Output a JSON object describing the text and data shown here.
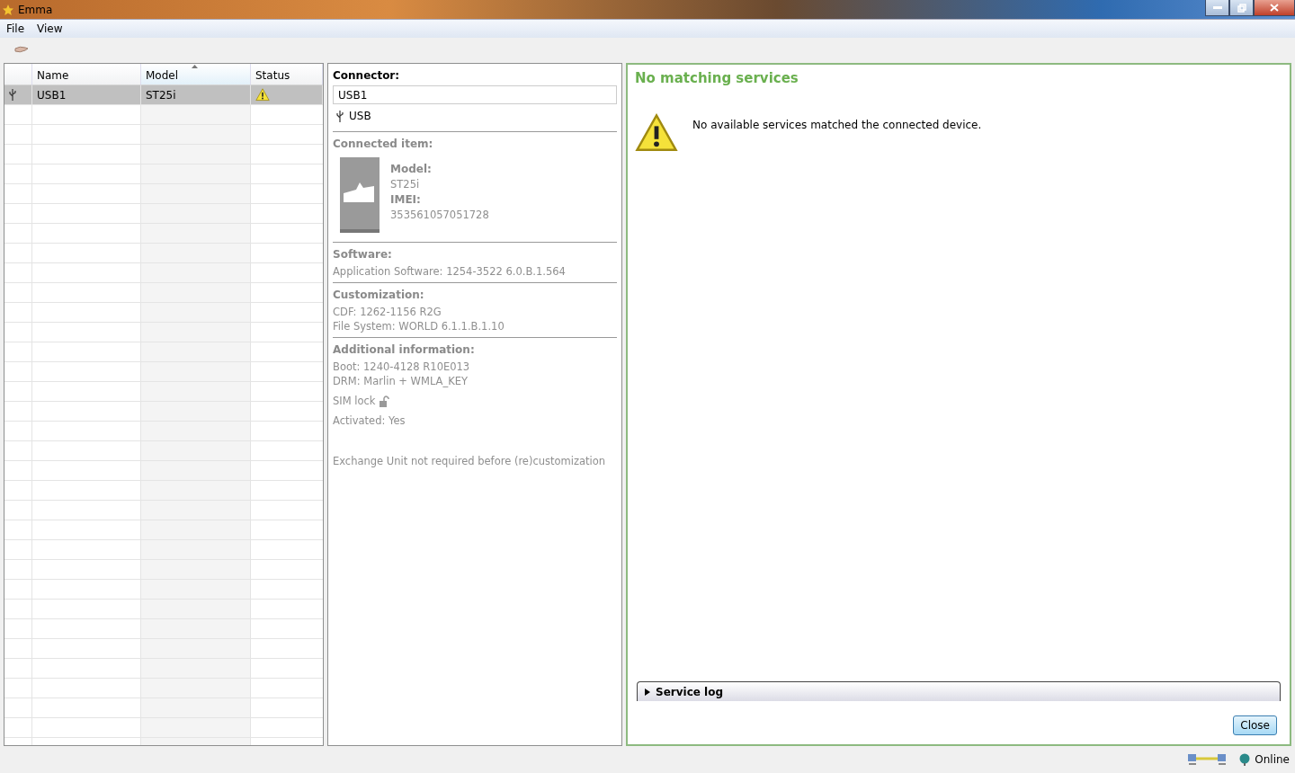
{
  "window": {
    "title": "Emma"
  },
  "menu": [
    "File",
    "View"
  ],
  "table": {
    "columns": [
      {
        "label": "Name",
        "sorted": false
      },
      {
        "label": "Model",
        "sorted": true
      },
      {
        "label": "Status",
        "sorted": false
      }
    ],
    "rows": [
      {
        "name": "USB1",
        "model": "ST25i",
        "kind": "warning",
        "selected": true
      }
    ]
  },
  "details": {
    "connector_label": "Connector:",
    "connector_value": "USB1",
    "connector_type": "USB",
    "connected_item_label": "Connected item:",
    "item_fields": [
      {
        "label": "Model:",
        "value": "ST25i"
      },
      {
        "label": "IMEI:",
        "value": "353561057051728"
      }
    ],
    "sections": [
      {
        "title": "Software:",
        "lines": [
          "Application Software: 1254-3522 6.0.B.1.564"
        ]
      },
      {
        "title": "Customization:",
        "lines": [
          "CDF: 1262-1156 R2G",
          "File System: WORLD 6.1.1.B.1.10"
        ]
      },
      {
        "title": "Additional information:",
        "lines": [
          "Boot: 1240-4128 R10E013",
          "DRM: Marlin + WMLA_KEY"
        ]
      }
    ],
    "sim_lock": {
      "label": "SIM lock",
      "locked": false
    },
    "activated": "Activated: Yes",
    "note": "Exchange Unit not required before (re)customization"
  },
  "services": {
    "title": "No matching services",
    "message": "No available services matched the connected device.",
    "log": {
      "label": "Service log",
      "expanded": false
    },
    "close": "Close"
  },
  "status_bar": {
    "status": "Online"
  }
}
